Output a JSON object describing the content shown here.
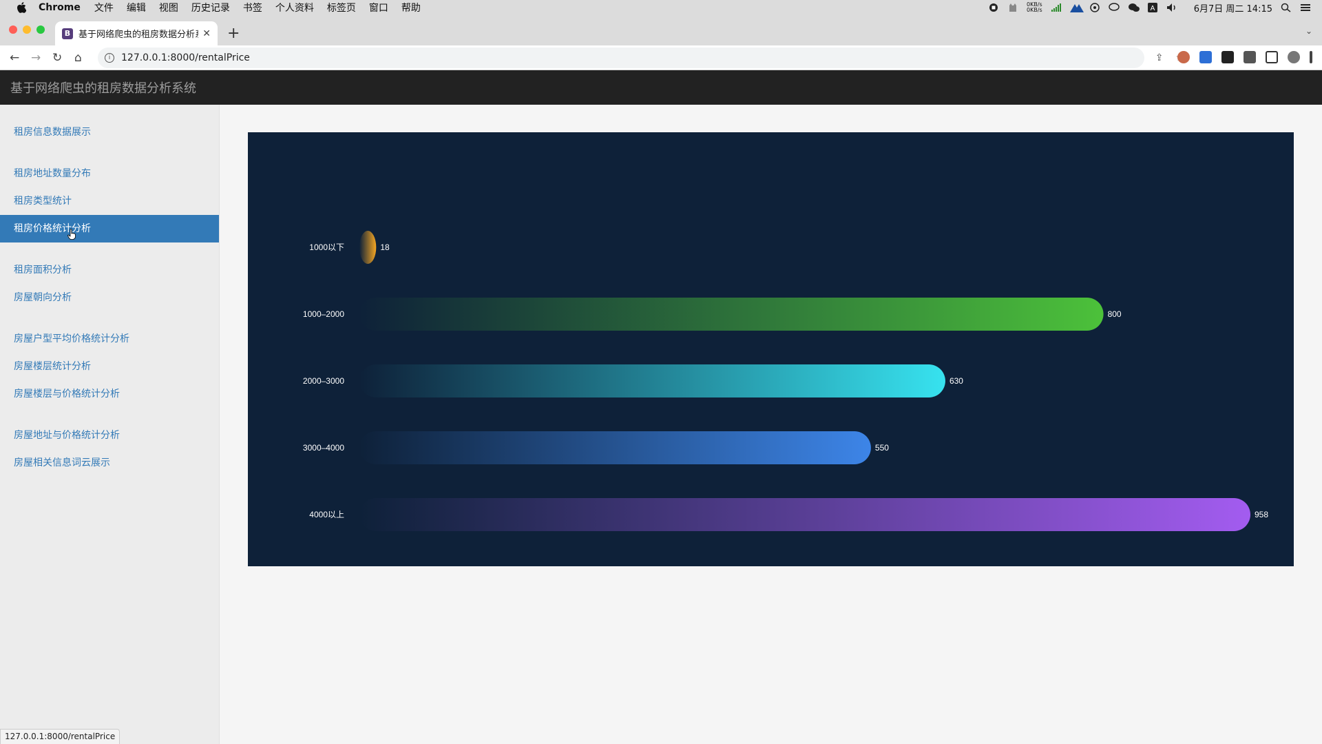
{
  "menubar": {
    "app_name": "Chrome",
    "items": [
      "文件",
      "编辑",
      "视图",
      "历史记录",
      "书签",
      "个人资料",
      "标签页",
      "窗口",
      "帮助"
    ],
    "net_up": "0KB/s",
    "net_down": "0KB/s",
    "datetime": "6月7日 周二 14:15"
  },
  "browser": {
    "tab_title": "基于网络爬虫的租房数据分析系统",
    "tab_favicon": "B",
    "url": "127.0.0.1:8000/rentalPrice",
    "status_url": "127.0.0.1:8000/rentalPrice"
  },
  "app": {
    "brand": "基于网络爬虫的租房数据分析系统"
  },
  "sidebar": {
    "groups": [
      [
        "租房信息数据展示"
      ],
      [
        "租房地址数量分布",
        "租房类型统计",
        "租房价格统计分析"
      ],
      [
        "租房面积分析",
        "房屋朝向分析"
      ],
      [
        "房屋户型平均价格统计分析",
        "房屋楼层统计分析",
        "房屋楼层与价格统计分析"
      ],
      [
        "房屋地址与价格统计分析",
        "房屋相关信息词云展示"
      ]
    ],
    "active": "租房价格统计分析"
  },
  "chart_data": {
    "type": "bar",
    "orientation": "horizontal",
    "categories": [
      "1000以下",
      "1000–2000",
      "2000–3000",
      "3000–4000",
      "4000以上"
    ],
    "values": [
      18,
      800,
      630,
      550,
      958
    ],
    "colors": [
      "#f5a623",
      "#4cc13a",
      "#37e2ef",
      "#3d85e8",
      "#a35cf0"
    ],
    "background": "#0e2139",
    "grid": false
  }
}
